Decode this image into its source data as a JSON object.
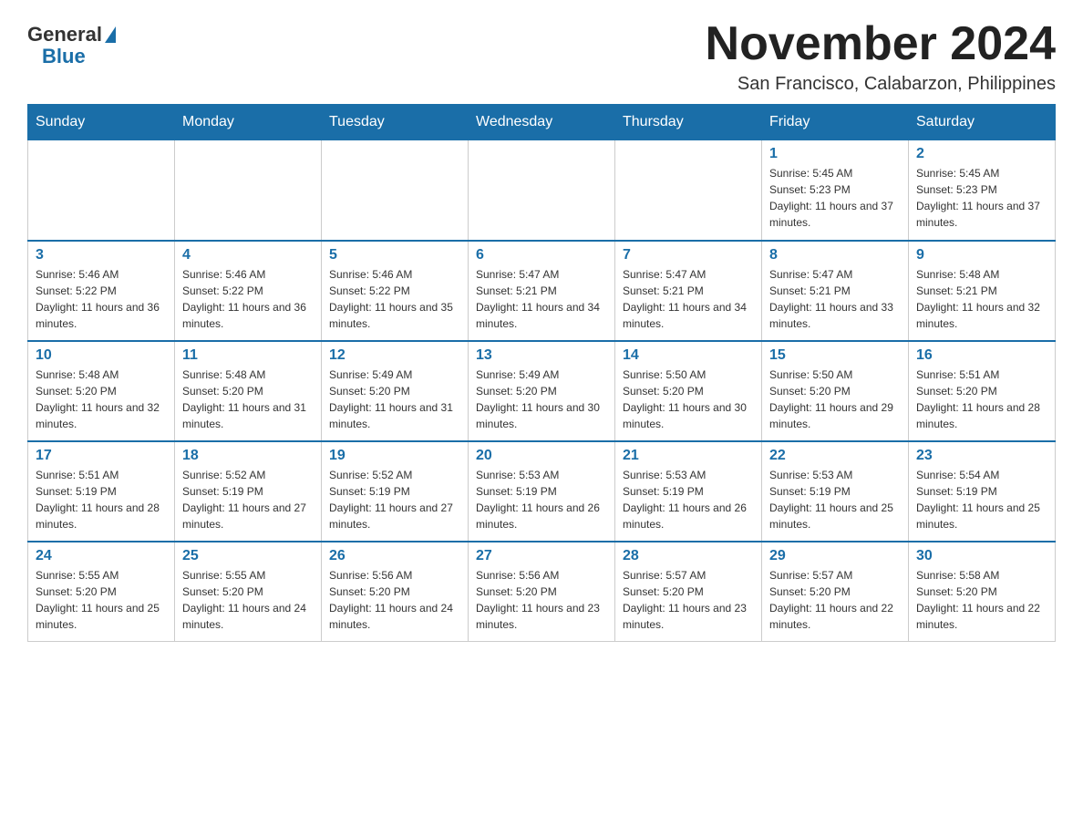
{
  "header": {
    "logo_general": "General",
    "logo_blue": "Blue",
    "month_title": "November 2024",
    "location": "San Francisco, Calabarzon, Philippines"
  },
  "days_of_week": [
    "Sunday",
    "Monday",
    "Tuesday",
    "Wednesday",
    "Thursday",
    "Friday",
    "Saturday"
  ],
  "weeks": [
    [
      {
        "day": "",
        "info": ""
      },
      {
        "day": "",
        "info": ""
      },
      {
        "day": "",
        "info": ""
      },
      {
        "day": "",
        "info": ""
      },
      {
        "day": "",
        "info": ""
      },
      {
        "day": "1",
        "info": "Sunrise: 5:45 AM\nSunset: 5:23 PM\nDaylight: 11 hours and 37 minutes."
      },
      {
        "day": "2",
        "info": "Sunrise: 5:45 AM\nSunset: 5:23 PM\nDaylight: 11 hours and 37 minutes."
      }
    ],
    [
      {
        "day": "3",
        "info": "Sunrise: 5:46 AM\nSunset: 5:22 PM\nDaylight: 11 hours and 36 minutes."
      },
      {
        "day": "4",
        "info": "Sunrise: 5:46 AM\nSunset: 5:22 PM\nDaylight: 11 hours and 36 minutes."
      },
      {
        "day": "5",
        "info": "Sunrise: 5:46 AM\nSunset: 5:22 PM\nDaylight: 11 hours and 35 minutes."
      },
      {
        "day": "6",
        "info": "Sunrise: 5:47 AM\nSunset: 5:21 PM\nDaylight: 11 hours and 34 minutes."
      },
      {
        "day": "7",
        "info": "Sunrise: 5:47 AM\nSunset: 5:21 PM\nDaylight: 11 hours and 34 minutes."
      },
      {
        "day": "8",
        "info": "Sunrise: 5:47 AM\nSunset: 5:21 PM\nDaylight: 11 hours and 33 minutes."
      },
      {
        "day": "9",
        "info": "Sunrise: 5:48 AM\nSunset: 5:21 PM\nDaylight: 11 hours and 32 minutes."
      }
    ],
    [
      {
        "day": "10",
        "info": "Sunrise: 5:48 AM\nSunset: 5:20 PM\nDaylight: 11 hours and 32 minutes."
      },
      {
        "day": "11",
        "info": "Sunrise: 5:48 AM\nSunset: 5:20 PM\nDaylight: 11 hours and 31 minutes."
      },
      {
        "day": "12",
        "info": "Sunrise: 5:49 AM\nSunset: 5:20 PM\nDaylight: 11 hours and 31 minutes."
      },
      {
        "day": "13",
        "info": "Sunrise: 5:49 AM\nSunset: 5:20 PM\nDaylight: 11 hours and 30 minutes."
      },
      {
        "day": "14",
        "info": "Sunrise: 5:50 AM\nSunset: 5:20 PM\nDaylight: 11 hours and 30 minutes."
      },
      {
        "day": "15",
        "info": "Sunrise: 5:50 AM\nSunset: 5:20 PM\nDaylight: 11 hours and 29 minutes."
      },
      {
        "day": "16",
        "info": "Sunrise: 5:51 AM\nSunset: 5:20 PM\nDaylight: 11 hours and 28 minutes."
      }
    ],
    [
      {
        "day": "17",
        "info": "Sunrise: 5:51 AM\nSunset: 5:19 PM\nDaylight: 11 hours and 28 minutes."
      },
      {
        "day": "18",
        "info": "Sunrise: 5:52 AM\nSunset: 5:19 PM\nDaylight: 11 hours and 27 minutes."
      },
      {
        "day": "19",
        "info": "Sunrise: 5:52 AM\nSunset: 5:19 PM\nDaylight: 11 hours and 27 minutes."
      },
      {
        "day": "20",
        "info": "Sunrise: 5:53 AM\nSunset: 5:19 PM\nDaylight: 11 hours and 26 minutes."
      },
      {
        "day": "21",
        "info": "Sunrise: 5:53 AM\nSunset: 5:19 PM\nDaylight: 11 hours and 26 minutes."
      },
      {
        "day": "22",
        "info": "Sunrise: 5:53 AM\nSunset: 5:19 PM\nDaylight: 11 hours and 25 minutes."
      },
      {
        "day": "23",
        "info": "Sunrise: 5:54 AM\nSunset: 5:19 PM\nDaylight: 11 hours and 25 minutes."
      }
    ],
    [
      {
        "day": "24",
        "info": "Sunrise: 5:55 AM\nSunset: 5:20 PM\nDaylight: 11 hours and 25 minutes."
      },
      {
        "day": "25",
        "info": "Sunrise: 5:55 AM\nSunset: 5:20 PM\nDaylight: 11 hours and 24 minutes."
      },
      {
        "day": "26",
        "info": "Sunrise: 5:56 AM\nSunset: 5:20 PM\nDaylight: 11 hours and 24 minutes."
      },
      {
        "day": "27",
        "info": "Sunrise: 5:56 AM\nSunset: 5:20 PM\nDaylight: 11 hours and 23 minutes."
      },
      {
        "day": "28",
        "info": "Sunrise: 5:57 AM\nSunset: 5:20 PM\nDaylight: 11 hours and 23 minutes."
      },
      {
        "day": "29",
        "info": "Sunrise: 5:57 AM\nSunset: 5:20 PM\nDaylight: 11 hours and 22 minutes."
      },
      {
        "day": "30",
        "info": "Sunrise: 5:58 AM\nSunset: 5:20 PM\nDaylight: 11 hours and 22 minutes."
      }
    ]
  ]
}
